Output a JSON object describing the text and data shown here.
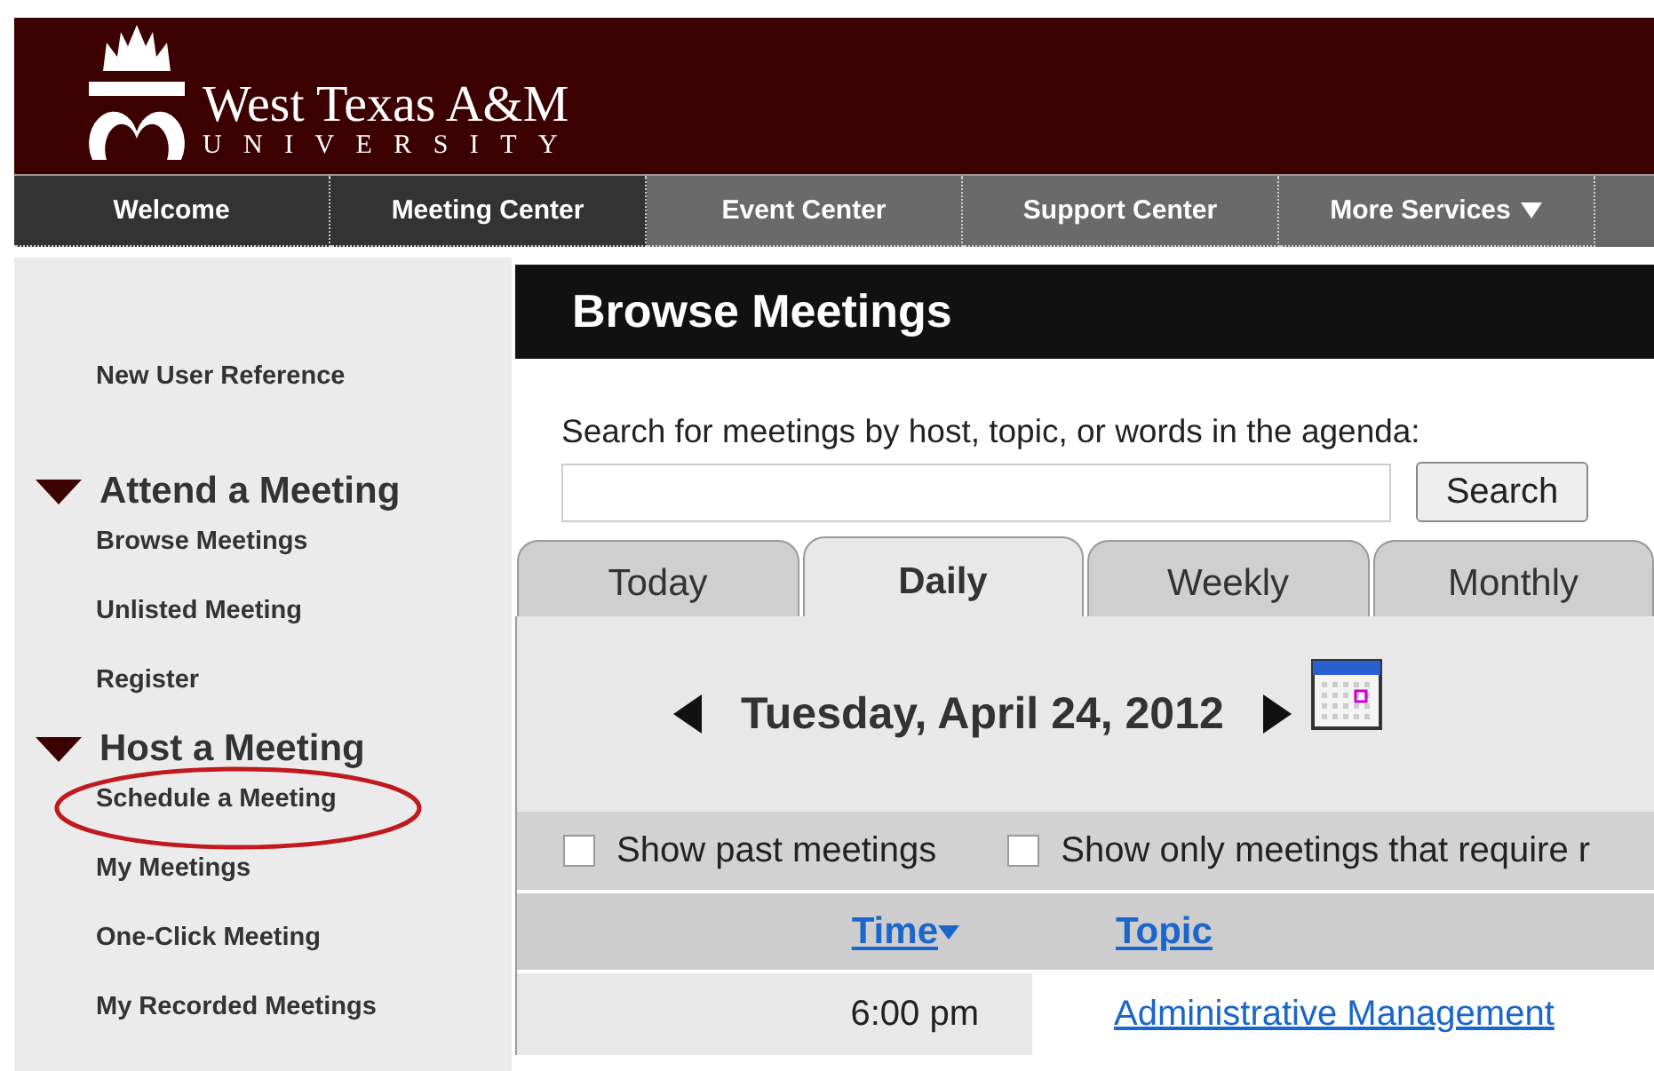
{
  "header": {
    "logo_name": "West Texas A&M",
    "logo_sub": "UNIVERSITY"
  },
  "nav": [
    {
      "label": "Welcome",
      "highlighted": true,
      "dropdown": false
    },
    {
      "label": "Meeting Center",
      "highlighted": true,
      "dropdown": false
    },
    {
      "label": "Event Center",
      "highlighted": false,
      "dropdown": false
    },
    {
      "label": "Support Center",
      "highlighted": false,
      "dropdown": false
    },
    {
      "label": "More Services",
      "highlighted": false,
      "dropdown": true
    }
  ],
  "sidebar": {
    "items": [
      {
        "kind": "link",
        "label": "New User Reference",
        "circled": false
      },
      {
        "kind": "heading",
        "label": "Attend a Meeting",
        "expanded": true
      },
      {
        "kind": "link",
        "label": "Browse Meetings",
        "circled": false
      },
      {
        "kind": "link",
        "label": "Unlisted Meeting",
        "circled": false
      },
      {
        "kind": "link",
        "label": "Register",
        "circled": false
      },
      {
        "kind": "heading",
        "label": "Host a Meeting",
        "expanded": true
      },
      {
        "kind": "link",
        "label": "Schedule a Meeting",
        "circled": true
      },
      {
        "kind": "link",
        "label": "My Meetings",
        "circled": false
      },
      {
        "kind": "link",
        "label": "One-Click Meeting",
        "circled": false
      },
      {
        "kind": "link",
        "label": "My Recorded Meetings",
        "circled": false
      }
    ]
  },
  "main": {
    "title": "Browse Meetings",
    "search": {
      "label": "Search for meetings by host, topic, or words in the agenda:",
      "button": "Search"
    },
    "tabs": [
      {
        "label": "Today",
        "selected": false
      },
      {
        "label": "Daily",
        "selected": true
      },
      {
        "label": "Weekly",
        "selected": false
      },
      {
        "label": "Monthly",
        "selected": false
      }
    ],
    "date": "Tuesday, April 24, 2012",
    "filters": [
      {
        "label": "Show past meetings",
        "checked": false
      },
      {
        "label": "Show only meetings that require r",
        "checked": false
      }
    ],
    "table": {
      "columns": [
        "Time",
        "Topic"
      ],
      "rows": [
        {
          "time": "6:00 pm",
          "topic": "Administrative Management"
        }
      ]
    }
  }
}
